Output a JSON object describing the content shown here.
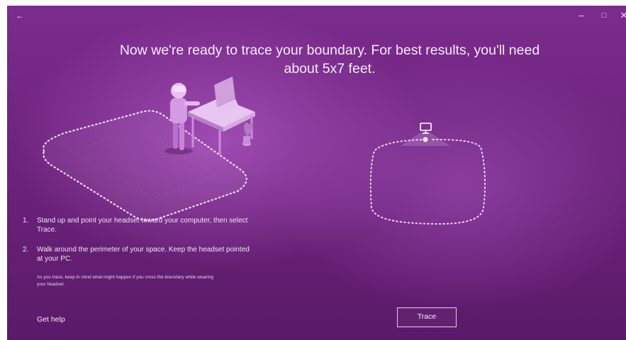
{
  "window": {
    "titlebar": {
      "back_icon": "back-arrow-icon",
      "minimize_icon": "minimize-icon",
      "maximize_icon": "maximize-icon",
      "close_icon": "close-icon"
    }
  },
  "main": {
    "headline": "Now we're ready to trace your boundary. For best results, you'll need about 5x7 feet.",
    "steps": [
      {
        "number": "1.",
        "text": "Stand up and point your headset toward your computer, then select Trace."
      },
      {
        "number": "2.",
        "text": "Walk around the perimeter of your space. Keep the headset pointed at your PC."
      }
    ],
    "note": "As you trace, keep in mind what might happen if you cross the boundary while wearing your headset.",
    "help_link": "Get help",
    "trace_button": "Trace"
  },
  "colors": {
    "background_top": "#7b2c8d",
    "background_bottom": "#5b1a69",
    "text": "#f6ecf8",
    "button_border": "#e7c9ee"
  },
  "icons": [
    "back-arrow-icon",
    "minimize-icon",
    "maximize-icon",
    "close-icon",
    "monitor-icon"
  ]
}
